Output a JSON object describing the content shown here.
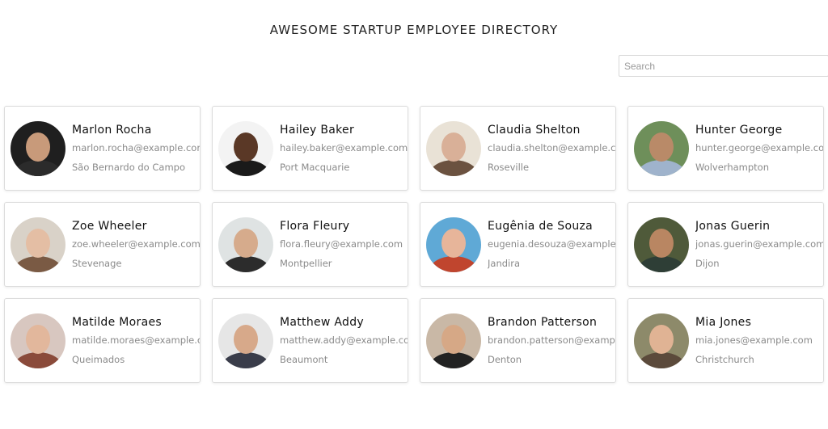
{
  "header": {
    "title": "AWESOME STARTUP EMPLOYEE DIRECTORY"
  },
  "search": {
    "placeholder": "Search",
    "value": ""
  },
  "employees": [
    {
      "name": "Marlon Rocha",
      "email": "marlon.rocha@example.com",
      "city": "São Bernardo do Campo",
      "avatar_bg": "#1f1f1f",
      "avatar_skin": "#c89a7a",
      "avatar_clothes": "#2b2b2b"
    },
    {
      "name": "Hailey Baker",
      "email": "hailey.baker@example.com",
      "city": "Port Macquarie",
      "avatar_bg": "#f3f3f3",
      "avatar_skin": "#5a3826",
      "avatar_clothes": "#1a1a1a"
    },
    {
      "name": "Claudia Shelton",
      "email": "claudia.shelton@example.com",
      "city": "Roseville",
      "avatar_bg": "#e9e2d6",
      "avatar_skin": "#d9b098",
      "avatar_clothes": "#6b5240"
    },
    {
      "name": "Hunter George",
      "email": "hunter.george@example.com",
      "city": "Wolverhampton",
      "avatar_bg": "#6e8f5a",
      "avatar_skin": "#b98a68",
      "avatar_clothes": "#9fb3cc"
    },
    {
      "name": "Zoe Wheeler",
      "email": "zoe.wheeler@example.com",
      "city": "Stevenage",
      "avatar_bg": "#d9d2c8",
      "avatar_skin": "#e4bea4",
      "avatar_clothes": "#7a5a44"
    },
    {
      "name": "Flora Fleury",
      "email": "flora.fleury@example.com",
      "city": "Montpellier",
      "avatar_bg": "#dfe3e3",
      "avatar_skin": "#d6ab8c",
      "avatar_clothes": "#2c2c2c"
    },
    {
      "name": "Eugênia de Souza",
      "email": "eugenia.desouza@example.com",
      "city": "Jandira",
      "avatar_bg": "#5fa9d6",
      "avatar_skin": "#e7b59a",
      "avatar_clothes": "#c0452e"
    },
    {
      "name": "Jonas Guerin",
      "email": "jonas.guerin@example.com",
      "city": "Dijon",
      "avatar_bg": "#4f5a3a",
      "avatar_skin": "#b98662",
      "avatar_clothes": "#2e3e36"
    },
    {
      "name": "Matilde Moraes",
      "email": "matilde.moraes@example.com",
      "city": "Queimados",
      "avatar_bg": "#d8c7c0",
      "avatar_skin": "#e2b79c",
      "avatar_clothes": "#8a4a3a"
    },
    {
      "name": "Matthew Addy",
      "email": "matthew.addy@example.com",
      "city": "Beaumont",
      "avatar_bg": "#e6e6e6",
      "avatar_skin": "#d7a98a",
      "avatar_clothes": "#3a3d4a"
    },
    {
      "name": "Brandon Patterson",
      "email": "brandon.patterson@example.com",
      "city": "Denton",
      "avatar_bg": "#c9b8a6",
      "avatar_skin": "#d6a886",
      "avatar_clothes": "#222222"
    },
    {
      "name": "Mia Jones",
      "email": "mia.jones@example.com",
      "city": "Christchurch",
      "avatar_bg": "#8d8a6a",
      "avatar_skin": "#e0b394",
      "avatar_clothes": "#5b4a3b"
    }
  ]
}
